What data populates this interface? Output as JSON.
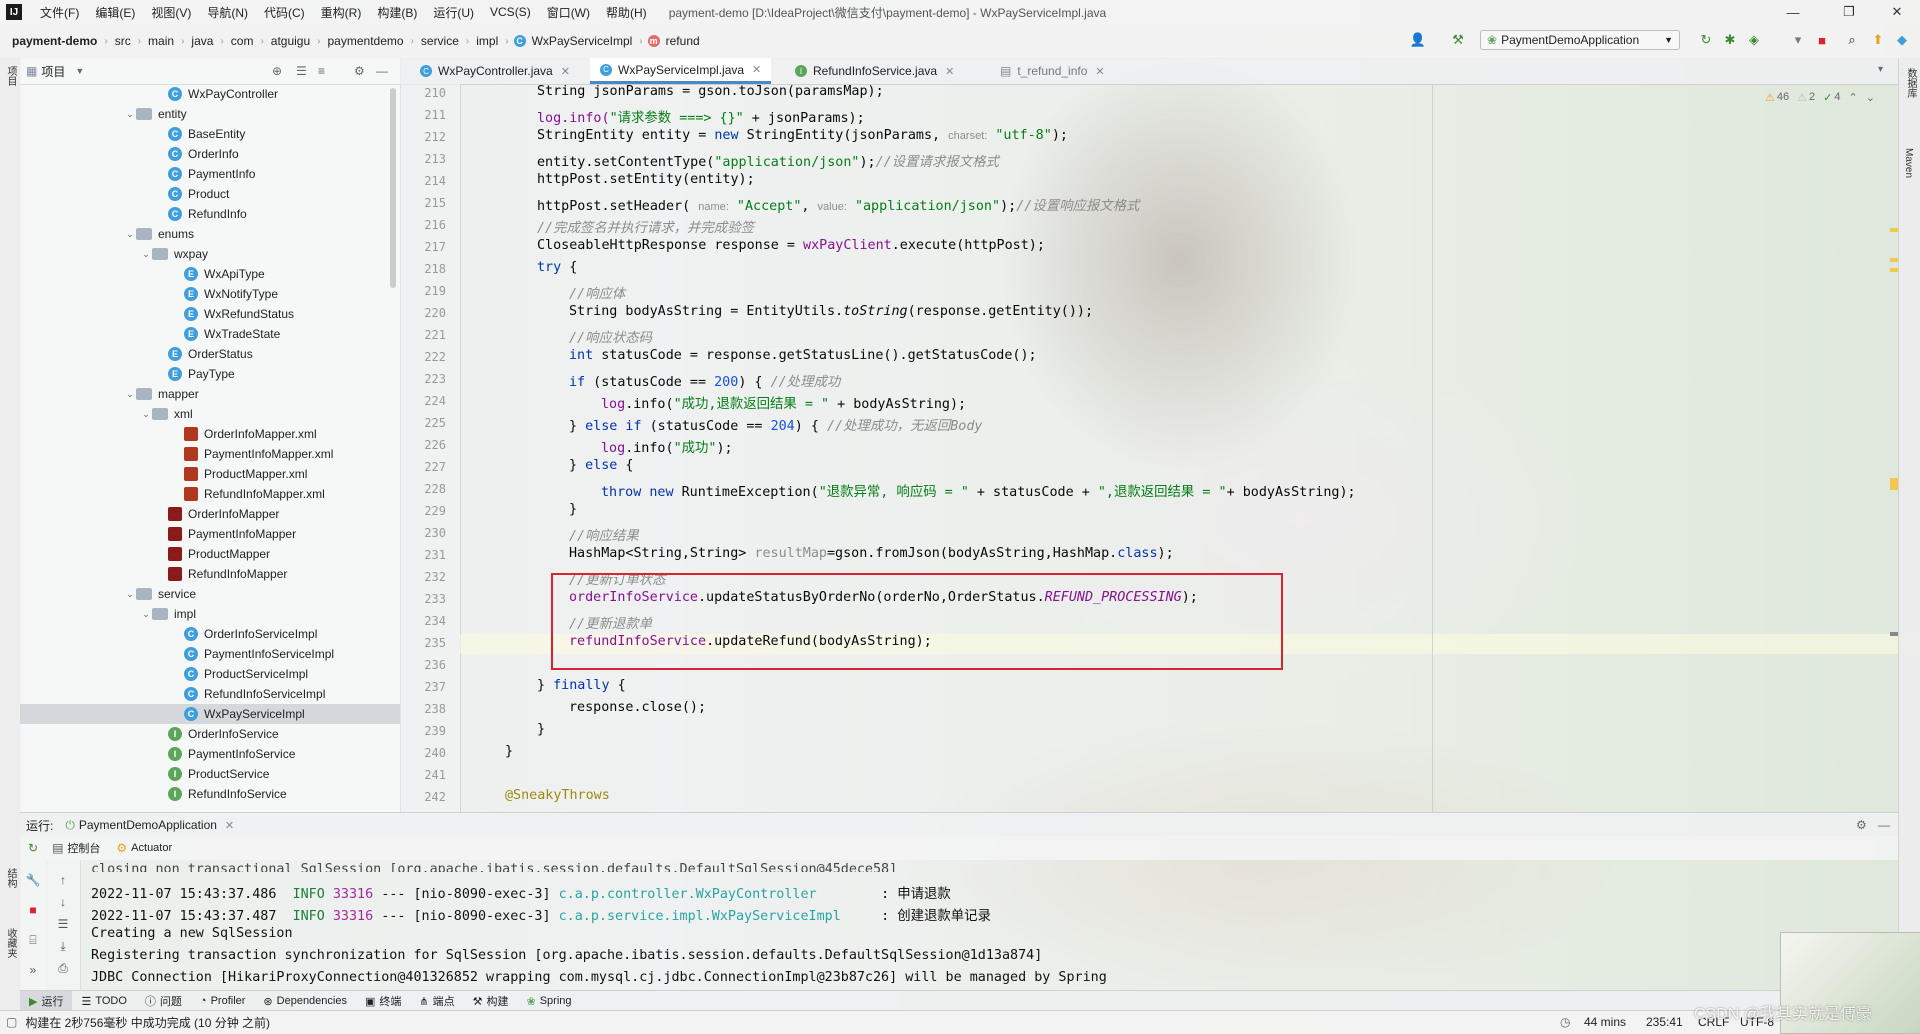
{
  "menubar": {
    "logo": "IJ",
    "items": [
      "文件(F)",
      "编辑(E)",
      "视图(V)",
      "导航(N)",
      "代码(C)",
      "重构(R)",
      "构建(B)",
      "运行(U)",
      "VCS(S)",
      "窗口(W)",
      "帮助(H)"
    ],
    "title": "payment-demo [D:\\IdeaProject\\微信支付\\payment-demo] - WxPayServiceImpl.java"
  },
  "breadcrumb": [
    "payment-demo",
    "src",
    "main",
    "java",
    "com",
    "atguigu",
    "paymentdemo",
    "service",
    "impl",
    "WxPayServiceImpl",
    "refund"
  ],
  "run_config": "PaymentDemoApplication",
  "project": {
    "title": "项目",
    "tree": [
      {
        "label": "WxPayController",
        "depth": 9,
        "type": "class"
      },
      {
        "label": "entity",
        "depth": 7,
        "type": "folder",
        "expanded": true
      },
      {
        "label": "BaseEntity",
        "depth": 9,
        "type": "class"
      },
      {
        "label": "OrderInfo",
        "depth": 9,
        "type": "class"
      },
      {
        "label": "PaymentInfo",
        "depth": 9,
        "type": "class"
      },
      {
        "label": "Product",
        "depth": 9,
        "type": "class"
      },
      {
        "label": "RefundInfo",
        "depth": 9,
        "type": "class"
      },
      {
        "label": "enums",
        "depth": 7,
        "type": "folder",
        "expanded": true
      },
      {
        "label": "wxpay",
        "depth": 8,
        "type": "folder",
        "expanded": true
      },
      {
        "label": "WxApiType",
        "depth": 10,
        "type": "enum"
      },
      {
        "label": "WxNotifyType",
        "depth": 10,
        "type": "enum"
      },
      {
        "label": "WxRefundStatus",
        "depth": 10,
        "type": "enum"
      },
      {
        "label": "WxTradeState",
        "depth": 10,
        "type": "enum"
      },
      {
        "label": "OrderStatus",
        "depth": 9,
        "type": "enum"
      },
      {
        "label": "PayType",
        "depth": 9,
        "type": "enum"
      },
      {
        "label": "mapper",
        "depth": 7,
        "type": "folder",
        "expanded": true
      },
      {
        "label": "xml",
        "depth": 8,
        "type": "folder",
        "expanded": true
      },
      {
        "label": "OrderInfoMapper.xml",
        "depth": 10,
        "type": "xml"
      },
      {
        "label": "PaymentInfoMapper.xml",
        "depth": 10,
        "type": "xml"
      },
      {
        "label": "ProductMapper.xml",
        "depth": 10,
        "type": "xml"
      },
      {
        "label": "RefundInfoMapper.xml",
        "depth": 10,
        "type": "xml"
      },
      {
        "label": "OrderInfoMapper",
        "depth": 9,
        "type": "mapper"
      },
      {
        "label": "PaymentInfoMapper",
        "depth": 9,
        "type": "mapper"
      },
      {
        "label": "ProductMapper",
        "depth": 9,
        "type": "mapper"
      },
      {
        "label": "RefundInfoMapper",
        "depth": 9,
        "type": "mapper"
      },
      {
        "label": "service",
        "depth": 7,
        "type": "folder",
        "expanded": true
      },
      {
        "label": "impl",
        "depth": 8,
        "type": "folder",
        "expanded": true
      },
      {
        "label": "OrderInfoServiceImpl",
        "depth": 10,
        "type": "class"
      },
      {
        "label": "PaymentInfoServiceImpl",
        "depth": 10,
        "type": "class"
      },
      {
        "label": "ProductServiceImpl",
        "depth": 10,
        "type": "class"
      },
      {
        "label": "RefundInfoServiceImpl",
        "depth": 10,
        "type": "class"
      },
      {
        "label": "WxPayServiceImpl",
        "depth": 10,
        "type": "class",
        "selected": true
      },
      {
        "label": "OrderInfoService",
        "depth": 9,
        "type": "interface"
      },
      {
        "label": "PaymentInfoService",
        "depth": 9,
        "type": "interface"
      },
      {
        "label": "ProductService",
        "depth": 9,
        "type": "interface"
      },
      {
        "label": "RefundInfoService",
        "depth": 9,
        "type": "interface"
      }
    ]
  },
  "editor": {
    "tabs": [
      {
        "label": "WxPayController.java",
        "icon": "class",
        "active": false
      },
      {
        "label": "WxPayServiceImpl.java",
        "icon": "class",
        "active": true
      },
      {
        "label": "RefundInfoService.java",
        "icon": "interface",
        "active": false
      },
      {
        "label": "t_refund_info",
        "icon": "table",
        "active": false
      }
    ],
    "inspections": {
      "warnings": "46",
      "weak": "2",
      "ok": "4"
    },
    "line_numbers": [
      "210",
      "211",
      "212",
      "213",
      "214",
      "215",
      "216",
      "217",
      "218",
      "219",
      "220",
      "221",
      "222",
      "223",
      "224",
      "225",
      "226",
      "227",
      "228",
      "229",
      "230",
      "231",
      "232",
      "233",
      "234",
      "235",
      "236",
      "237",
      "238",
      "239",
      "240",
      "241",
      "242"
    ],
    "code": {
      "l210": {
        "a": "String jsonParams = gson.toJson(paramsMap);"
      },
      "l211": {
        "a": "log.info(",
        "s": "\"请求参数 ===> {}\"",
        "b": " + jsonParams);"
      },
      "l212": {
        "a": "StringEntity entity = ",
        "k": "new",
        "b": " StringEntity(jsonParams, ",
        "h": "charset:",
        "s": "\"utf-8\"",
        "c": ");"
      },
      "l213": {
        "a": "entity.setContentType(",
        "s": "\"application/json\"",
        "b": ");",
        "cm": "//设置请求报文格式"
      },
      "l214": {
        "a": "httpPost.setEntity(entity);"
      },
      "l215": {
        "a": "httpPost.setHeader( ",
        "h1": "name:",
        "s1": "\"Accept\"",
        "b": ", ",
        "h2": "value:",
        "s2": "\"application/json\"",
        "c": ");",
        "cm": "//设置响应报文格式"
      },
      "l216": {
        "cm": "//完成签名并执行请求，并完成验签"
      },
      "l217": {
        "a": "CloseableHttpResponse response = ",
        "f": "wxPayClient",
        "b": ".execute(httpPost);"
      },
      "l218": {
        "k": "try",
        "b": " {"
      },
      "l219": {
        "cm": "//响应体"
      },
      "l220": {
        "a": "String bodyAsString = EntityUtils.",
        "it": "toString",
        "b": "(response.getEntity());"
      },
      "l221": {
        "cm": "//响应状态码"
      },
      "l222": {
        "k": "int",
        "b": " statusCode = response.getStatusLine().getStatusCode();"
      },
      "l223": {
        "k": "if",
        "a": " (statusCode == ",
        "n": "200",
        "b": ") { ",
        "cm": "//处理成功"
      },
      "l224": {
        "f": "log",
        "a": ".info(",
        "s": "\"成功,退款返回结果 = \"",
        "b": " + bodyAsString);"
      },
      "l225": {
        "a": "} ",
        "k1": "else if",
        "b": " (statusCode == ",
        "n": "204",
        "c": ") { ",
        "cm": "//处理成功，无返回Body"
      },
      "l226": {
        "f": "log",
        "a": ".info(",
        "s": "\"成功\"",
        "b": ");"
      },
      "l227": {
        "a": "} ",
        "k": "else",
        "b": " {"
      },
      "l228": {
        "k": "throw new",
        "a": " RuntimeException(",
        "s1": "\"退款异常, 响应码 = \"",
        "b": " + statusCode + ",
        "s2": "\",退款返回结果 = \"",
        "c": "+ bodyAsString);"
      },
      "l229": {
        "a": "}"
      },
      "l230": {
        "cm": "//响应结果"
      },
      "l231": {
        "a": "HashMap<String,String> ",
        "h": "resultMap",
        "b": "=gson.fromJson(bodyAsString,HashMap.",
        "k": "class",
        "c": ");"
      },
      "l232": {
        "cm": "//更新订单状态"
      },
      "l233": {
        "f": "orderInfoService",
        "a": ".updateStatusByOrderNo(orderNo,OrderStatus.",
        "fi": "REFUND_PROCESSING",
        "b": ");"
      },
      "l234": {
        "cm": "//更新退款单"
      },
      "l235": {
        "f": "refundInfoService",
        "a": ".updateRefund(bodyAsString);"
      },
      "l237": {
        "a": "} ",
        "k": "finally",
        "b": " {"
      },
      "l238": {
        "a": "response.close();"
      },
      "l239": {
        "a": "}"
      },
      "l240": {
        "a": "}"
      },
      "l242": {
        "ann": "@SneakyThrows"
      }
    }
  },
  "run": {
    "label": "运行:",
    "config": "PaymentDemoApplication",
    "subtabs": [
      "控制台",
      "Actuator"
    ],
    "console": [
      {
        "text": "closing non transactional SqlSession [org.apache.ibatis.session.defaults.DefaultSqlSession@45dece58]"
      },
      {
        "time": "2022-11-07 15:43:37.486",
        "level": "INFO",
        "pid": "33316",
        "thread": "--- [nio-8090-exec-3]",
        "logger": "c.a.p.controller.WxPayController",
        "msg": ": 申请退款"
      },
      {
        "time": "2022-11-07 15:43:37.487",
        "level": "INFO",
        "pid": "33316",
        "thread": "--- [nio-8090-exec-3]",
        "logger": "c.a.p.service.impl.WxPayServiceImpl",
        "msg": ": 创建退款单记录"
      },
      {
        "text": "Creating a new SqlSession"
      },
      {
        "text": "Registering transaction synchronization for SqlSession [org.apache.ibatis.session.defaults.DefaultSqlSession@1d13a874]"
      },
      {
        "text": "JDBC Connection [HikariProxyConnection@401326852 wrapping com.mysql.cj.jdbc.ConnectionImpl@23b87c26] will be managed by Spring"
      }
    ]
  },
  "bottom_tabs": [
    "运行",
    "TODO",
    "问题",
    "Profiler",
    "Dependencies",
    "终端",
    "端点",
    "构建",
    "Spring"
  ],
  "status": {
    "message": "构建在 2秒756毫秒 中成功完成 (10 分钟 之前)",
    "time": "44 mins",
    "position": "235:41",
    "line_sep": "CRLF",
    "encoding": "UTF-8"
  },
  "left_stripe": [
    "项目",
    "结构",
    "收藏夹"
  ],
  "right_stripe": [
    "数据库",
    "Maven"
  ],
  "watermark": "CSDN @我其实就是傅豪",
  "colors": {
    "keyword": "#0033b3",
    "string": "#067d17",
    "comment": "#8c8c8c",
    "field": "#871094",
    "highlight_box": "#d9232e"
  }
}
